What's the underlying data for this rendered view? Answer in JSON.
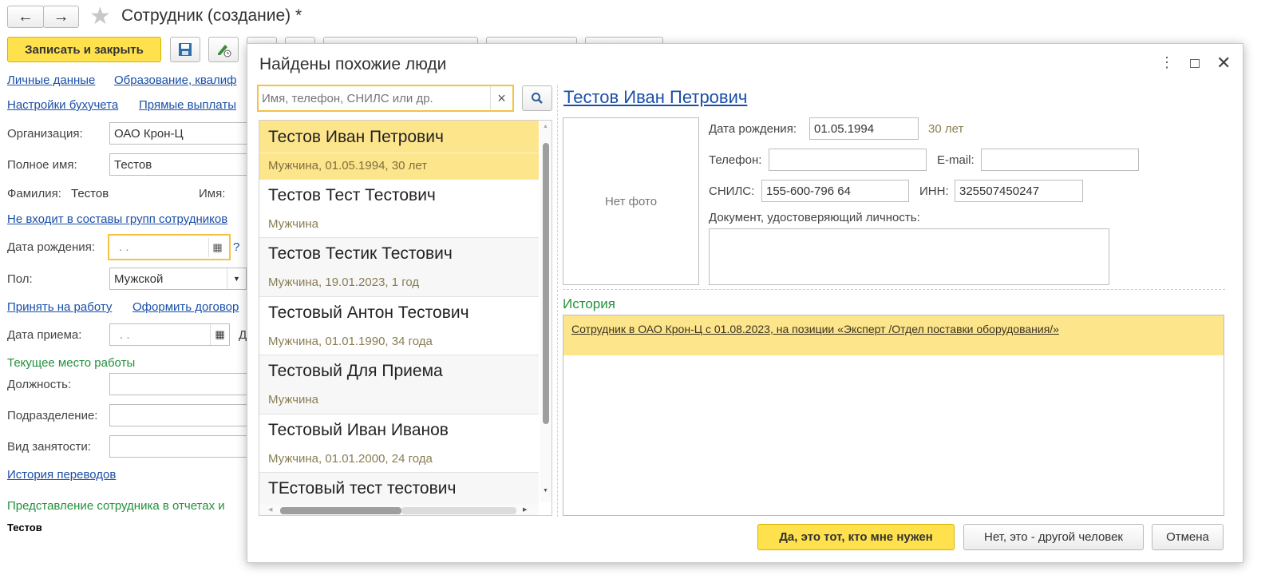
{
  "app": {
    "title": "Сотрудник (создание) *",
    "save_close": "Записать и закрыть",
    "links_row1": [
      "Личные данные",
      "Образование, квалиф"
    ],
    "links_row2": [
      "Настройки бухучета",
      "Прямые выплаты"
    ],
    "org_label": "Организация:",
    "org_value": "ОАО Крон-Ц",
    "fullname_label": "Полное имя:",
    "fullname_value": "Тестов",
    "surname_label": "Фамилия:",
    "surname_value": "Тестов",
    "name_label": "Имя:",
    "groups_link": "Не входит в составы групп сотрудников",
    "dob_label": "Дата рождения:",
    "dob_value": ". .",
    "help": "?",
    "gender_label": "Пол:",
    "gender_value": "Мужской",
    "hire_links": [
      "Принять на работу",
      "Оформить договор"
    ],
    "hire_date_label": "Дата приема:",
    "hire_date_value": ". .",
    "hire_cut": "Д",
    "workplace_title": "Текущее место работы",
    "position_label": "Должность:",
    "department_label": "Подразделение:",
    "employment_label": "Вид занятости:",
    "history_link": "История переводов",
    "presentation_title": "Представление сотрудника в отчетах и",
    "presentation_value": "Тестов"
  },
  "dialog": {
    "title": "Найдены похожие люди",
    "search_placeholder": "Имя, телефон, СНИЛС или др.",
    "clear": "×",
    "results": [
      {
        "name": "Тестов Иван Петрович",
        "info": "Мужчина, 01.05.1994, 30 лет"
      },
      {
        "name": "Тестов Тест Тестович",
        "info": "Мужчина"
      },
      {
        "name": "Тестов Тестик Тестович",
        "info": "Мужчина, 19.01.2023, 1 год"
      },
      {
        "name": "Тестовый Антон Тестович",
        "info": "Мужчина, 01.01.1990, 34 года"
      },
      {
        "name": "Тестовый Для Приема",
        "info": "Мужчина"
      },
      {
        "name": "Тестовый Иван Иванов",
        "info": "Мужчина, 01.01.2000, 24 года"
      },
      {
        "name": "ТЕстовый тест тестович",
        "info": ""
      }
    ],
    "person_name": "Тестов Иван Петрович",
    "no_photo": "Нет фото",
    "dob_label": "Дата рождения:",
    "dob_value": "01.05.1994",
    "age": "30 лет",
    "phone_label": "Телефон:",
    "phone_value": "",
    "email_label": "E-mail:",
    "email_value": "",
    "snils_label": "СНИЛС:",
    "snils_value": "155-600-796 64",
    "inn_label": "ИНН:",
    "inn_value": "325507450247",
    "doc_label": "Документ, удостоверяющий личность:",
    "doc_value": "",
    "history_title": "История",
    "history_entry": "Сотрудник в ОАО Крон-Ц с 01.08.2023, на позиции «Эксперт /Отдел поставки оборудования/»",
    "btn_yes": "Да, это тот, кто мне нужен",
    "btn_no": "Нет, это - другой человек",
    "btn_cancel": "Отмена"
  },
  "colors": {
    "accent_yellow": "#ffe14d",
    "selected_row": "#fde58c",
    "link": "#1a4fa8",
    "group_green": "#22913b"
  }
}
